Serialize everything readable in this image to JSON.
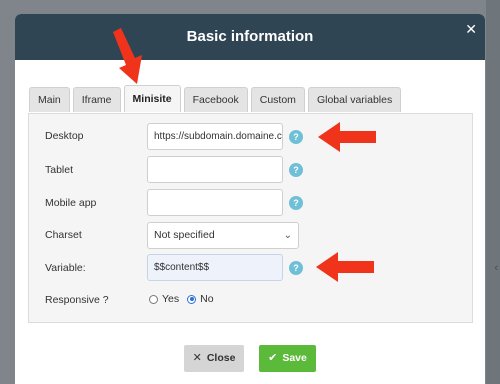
{
  "dialog": {
    "title": "Basic information",
    "close_icon": "✕"
  },
  "tabs": [
    {
      "label": "Main"
    },
    {
      "label": "Iframe"
    },
    {
      "label": "Minisite",
      "active": true
    },
    {
      "label": "Facebook"
    },
    {
      "label": "Custom"
    },
    {
      "label": "Global variables"
    }
  ],
  "form": {
    "desktop": {
      "label": "Desktop",
      "value": "https://subdomain.domaine.c"
    },
    "tablet": {
      "label": "Tablet",
      "value": ""
    },
    "mobile": {
      "label": "Mobile app",
      "value": ""
    },
    "charset": {
      "label": "Charset",
      "selected": "Not specified"
    },
    "variable": {
      "label": "Variable:",
      "value": "$$content$$"
    },
    "responsive": {
      "label": "Responsive ?",
      "options": [
        "Yes",
        "No"
      ],
      "selected": "No"
    },
    "help_glyph": "?"
  },
  "buttons": {
    "close_label": "Close",
    "save_label": "Save"
  },
  "colors": {
    "header_bg": "#2f4554",
    "save_bg": "#5cba3b",
    "help_bg": "#6fc0d6",
    "annotation_arrow": "#f0341c"
  }
}
